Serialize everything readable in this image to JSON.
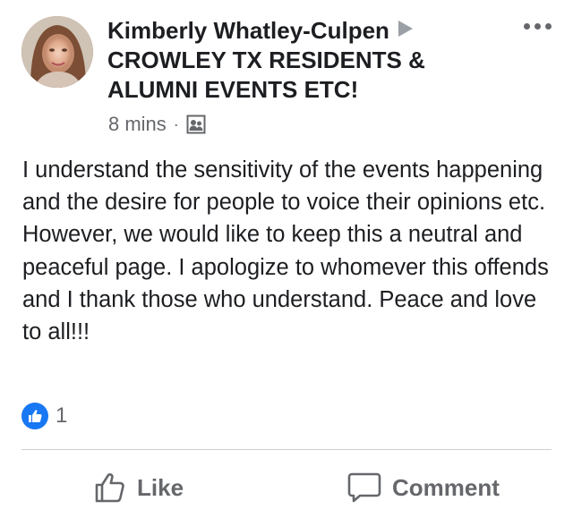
{
  "post": {
    "author": "Kimberly Whatley-Culpen",
    "group_line1": "CROWLEY TX RESIDENTS &",
    "group_line2": "ALUMNI EVENTS ETC!",
    "time": "8 mins",
    "separator": "·",
    "audience_icon": "members-icon",
    "text": "I understand the sensitivity of the events happening and the desire for people to voice their opinions etc.  However, we would like to keep this a neutral and peaceful page.   I apologize to whomever this offends and I thank those who understand.  Peace and love to all!!!"
  },
  "reactions": {
    "icon": "like-reaction-icon",
    "count": "1"
  },
  "actions": {
    "like_label": "Like",
    "comment_label": "Comment"
  },
  "colors": {
    "primary_text": "#1c1e21",
    "secondary_text": "#65676b",
    "like_blue": "#1877f2",
    "divider": "#ced0d4"
  }
}
